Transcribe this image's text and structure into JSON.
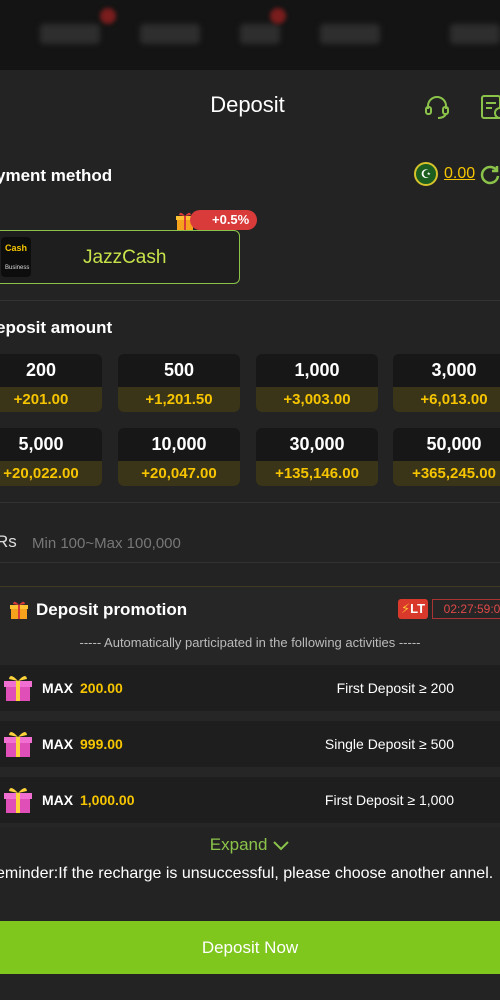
{
  "header": {
    "title": "Deposit"
  },
  "payment": {
    "heading": "yment method",
    "balance": "0.00"
  },
  "method": {
    "name": "JazzCash",
    "bonus": "+0.5%",
    "logo_top": "Cash",
    "logo_bottom": "Business"
  },
  "amount": {
    "heading": "eposit amount",
    "options": [
      {
        "value": "200",
        "bonus": "+201.00"
      },
      {
        "value": "500",
        "bonus": "+1,201.50"
      },
      {
        "value": "1,000",
        "bonus": "+3,003.00"
      },
      {
        "value": "3,000",
        "bonus": "+6,013.00"
      },
      {
        "value": "5,000",
        "bonus": "+20,022.00"
      },
      {
        "value": "10,000",
        "bonus": "+20,047.00"
      },
      {
        "value": "30,000",
        "bonus": "+135,146.00"
      },
      {
        "value": "50,000",
        "bonus": "+365,245.00"
      }
    ],
    "currency": "Rs",
    "placeholder": "Min 100~Max 100,000"
  },
  "promo": {
    "title": "Deposit promotion",
    "badge": "LT",
    "timer": "02:27:59:0",
    "note": "----- Automatically participated in the following activities -----",
    "rows": [
      {
        "label": "MAX",
        "value": "200.00",
        "condition": "First Deposit ≥ 200"
      },
      {
        "label": "MAX",
        "value": "999.00",
        "condition": "Single Deposit ≥ 500"
      },
      {
        "label": "MAX",
        "value": "1,000.00",
        "condition": "First Deposit ≥ 1,000"
      }
    ]
  },
  "expand_label": "Expand",
  "reminder": "eminder:If the recharge is unsuccessful, please choose another annel.",
  "submit_label": "Deposit Now",
  "colors": {
    "accent": "#7fc61d",
    "gold": "#f6c500",
    "bg": "#232323"
  }
}
